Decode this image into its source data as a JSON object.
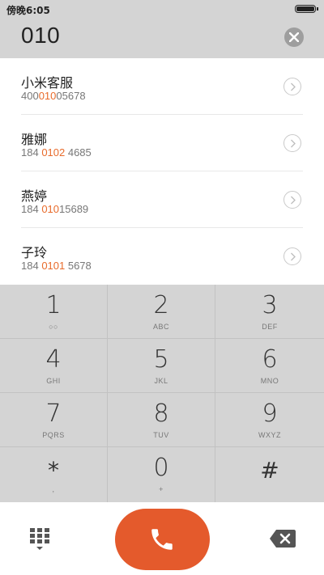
{
  "status_bar": {
    "time": "傍晚6:05"
  },
  "dialer": {
    "number": "010"
  },
  "results": [
    {
      "name": "小米客服",
      "num_before": "400",
      "num_match": "010",
      "num_after": "05678"
    },
    {
      "name": "雅娜",
      "num_before": "184 ",
      "num_match": "0102",
      "num_after": " 4685"
    },
    {
      "name": "燕婷",
      "num_before": "184 ",
      "num_match": "010",
      "num_after": "15689"
    },
    {
      "name": "子玲",
      "num_before": "184 ",
      "num_match": "0101",
      "num_after": " 5678"
    }
  ],
  "keypad": {
    "keys": [
      {
        "digit": "1",
        "letters": "○○"
      },
      {
        "digit": "2",
        "letters": "ABC"
      },
      {
        "digit": "3",
        "letters": "DEF"
      },
      {
        "digit": "4",
        "letters": "GHI"
      },
      {
        "digit": "5",
        "letters": "JKL"
      },
      {
        "digit": "6",
        "letters": "MNO"
      },
      {
        "digit": "7",
        "letters": "PQRS"
      },
      {
        "digit": "8",
        "letters": "TUV"
      },
      {
        "digit": "9",
        "letters": "WXYZ"
      },
      {
        "digit": "*",
        "letters": ","
      },
      {
        "digit": "0",
        "letters": "+"
      },
      {
        "digit": "#",
        "letters": ""
      }
    ]
  },
  "icons": {
    "clear": "close-circle-icon",
    "detail": "chevron-right-circle-icon",
    "call": "phone-icon",
    "keypad_toggle": "dialpad-grid-icon",
    "backspace": "backspace-icon"
  },
  "colors": {
    "accent": "#e45a2c",
    "highlight": "#e86b2b",
    "panel": "#d4d4d4"
  }
}
